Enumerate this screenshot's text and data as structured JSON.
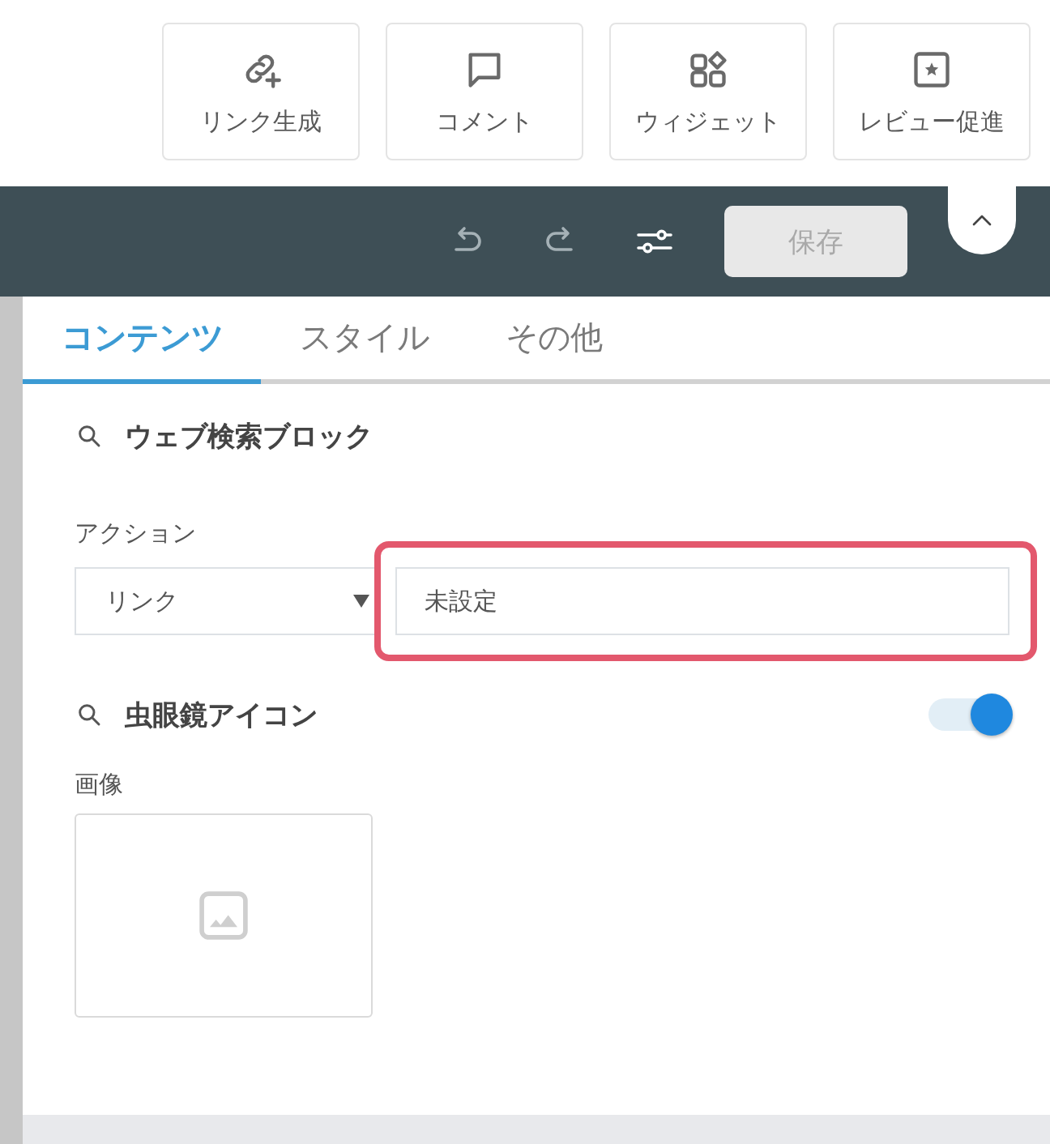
{
  "toolbar": {
    "buttons": [
      {
        "kind": "link",
        "label": "リンク生成"
      },
      {
        "kind": "comment",
        "label": "コメント"
      },
      {
        "kind": "widget",
        "label": "ウィジェット"
      },
      {
        "kind": "review",
        "label": "レビュー促進"
      }
    ]
  },
  "editor_bar": {
    "tools": [
      {
        "kind": "undo",
        "disabled": true
      },
      {
        "kind": "redo",
        "disabled": true
      },
      {
        "kind": "adjust",
        "disabled": false
      }
    ],
    "save_button": {
      "label": "保存",
      "disabled": true
    }
  },
  "tabs": [
    {
      "label": "コンテンツ",
      "selected": true
    },
    {
      "label": "スタイル",
      "selected": false
    },
    {
      "label": "その他",
      "selected": false
    }
  ],
  "web_search_block": {
    "heading": "ウェブ検索ブロック",
    "action_label": "アクション",
    "action_select": {
      "value": "リンク"
    },
    "link_field": {
      "value": "未設定",
      "highlighted": true
    }
  },
  "magnifier_icon": {
    "heading": "虫眼鏡アイコン",
    "toggle": {
      "on": true
    },
    "image_label": "画像"
  }
}
